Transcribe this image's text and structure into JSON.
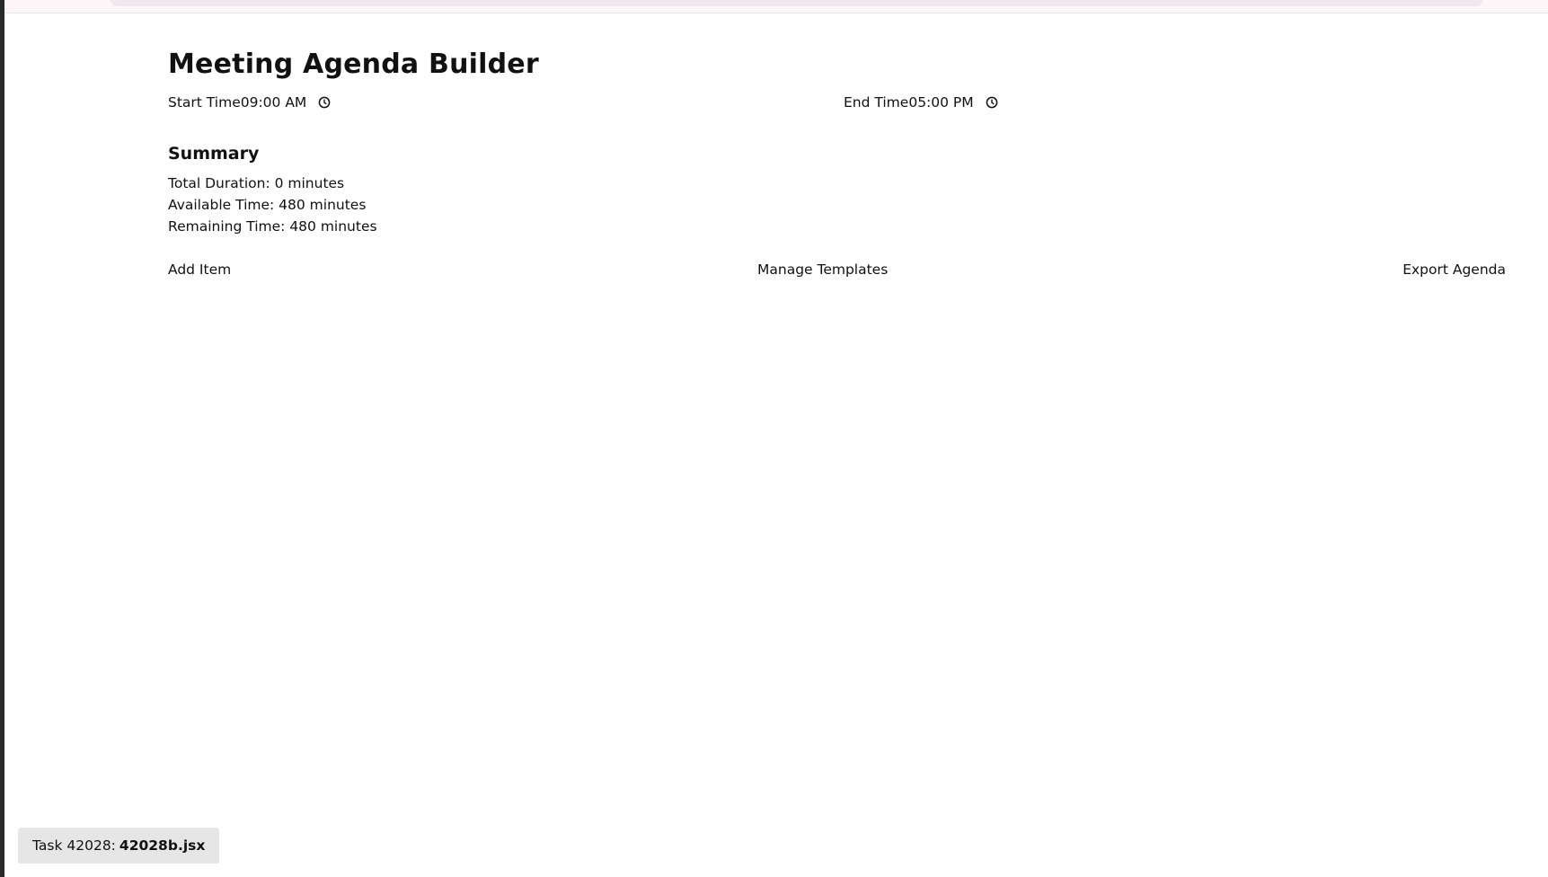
{
  "app": {
    "title": "Meeting Agenda Builder"
  },
  "times": {
    "start_label": "Start Time",
    "start_value": "09:00 AM",
    "end_label": "End Time",
    "end_value": "05:00 PM"
  },
  "summary": {
    "heading": "Summary",
    "total_duration": "Total Duration: 0 minutes",
    "available_time": "Available Time: 480 minutes",
    "remaining_time": "Remaining Time: 480 minutes"
  },
  "actions": {
    "add_item": "Add Item",
    "manage_templates": "Manage Templates",
    "export_agenda": "Export Agenda"
  },
  "task_tag": {
    "prefix": "Task 42028:",
    "filename": "42028b.jsx"
  },
  "icons": {
    "clock": "clock-icon"
  }
}
